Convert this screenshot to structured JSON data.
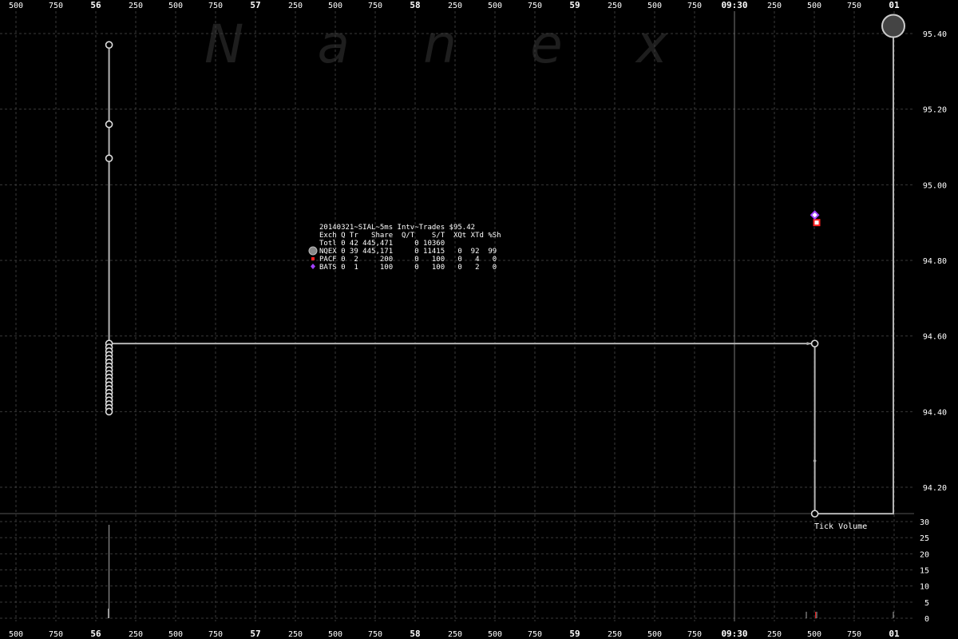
{
  "watermark": "Nanex",
  "info": {
    "title": "20140321~SIAL~5ms Intv~Trades $95.42",
    "header": "Exch Q Tr   Share  Q/T    S/T  XQt XTd %Sh",
    "rows": [
      {
        "text": "Totl 0 42 445,471     0 10360",
        "marker": "none",
        "color": ""
      },
      {
        "text": "NQEX 0 39 445,171     0 11415   0  92  99",
        "marker": "circle",
        "color": "#aaaaaa"
      },
      {
        "text": "PACF 0  2     200     0   100   0   4   0",
        "marker": "square",
        "color": "#ff2020"
      },
      {
        "text": "BATS 0  1     100     0   100   0   2   0",
        "marker": "diamond",
        "color": "#a040ff"
      }
    ]
  },
  "volume_title": "Tick Volume",
  "colors": {
    "background": "#000000",
    "grid": "#3a3a3a",
    "price_line": "#b4b4b4",
    "nqex": "#aaaaaa",
    "pacf": "#ff2020",
    "bats": "#a040ff"
  },
  "chart_data": [
    {
      "type": "line",
      "title": "20140321~SIAL~5ms Intv~Trades $95.42",
      "x_unit": "milliseconds within the minute (timeline around 09:30)",
      "x_tick_labels": [
        "500",
        "750",
        "56",
        "250",
        "500",
        "750",
        "57",
        "250",
        "500",
        "750",
        "58",
        "250",
        "500",
        "750",
        "59",
        "250",
        "500",
        "750",
        "09:30",
        "250",
        "500",
        "750",
        "01"
      ],
      "x_major_labels": [
        "56",
        "57",
        "58",
        "59",
        "09:30",
        "01"
      ],
      "ylim": [
        94.1,
        95.5
      ],
      "y_ticks": [
        "95.40",
        "95.20",
        "95.00",
        "94.80",
        "94.60",
        "94.40",
        "94.20"
      ],
      "grid": true,
      "series": [
        {
          "name": "NQEX",
          "points": [
            {
              "x": 583,
              "y": 95.37
            },
            {
              "x": 583,
              "y": 95.16
            },
            {
              "x": 583,
              "y": 95.07
            },
            {
              "x": 583,
              "y": 94.58
            },
            {
              "x": 583,
              "y": 94.57
            },
            {
              "x": 583,
              "y": 94.56
            },
            {
              "x": 583,
              "y": 94.55
            },
            {
              "x": 583,
              "y": 94.54
            },
            {
              "x": 583,
              "y": 94.53
            },
            {
              "x": 583,
              "y": 94.52
            },
            {
              "x": 583,
              "y": 94.51
            },
            {
              "x": 583,
              "y": 94.5
            },
            {
              "x": 583,
              "y": 94.49
            },
            {
              "x": 583,
              "y": 94.48
            },
            {
              "x": 583,
              "y": 94.47
            },
            {
              "x": 583,
              "y": 94.46
            },
            {
              "x": 583,
              "y": 94.45
            },
            {
              "x": 583,
              "y": 94.44
            },
            {
              "x": 583,
              "y": 94.43
            },
            {
              "x": 583,
              "y": 94.42
            },
            {
              "x": 583,
              "y": 94.41
            },
            {
              "x": 583,
              "y": 94.4
            },
            {
              "x": 4958,
              "y": 94.58
            },
            {
              "x": 5003,
              "y": 94.58
            },
            {
              "x": 5003,
              "y": 94.27
            },
            {
              "x": 5003,
              "y": 94.13
            },
            {
              "x": 5495,
              "y": 95.42
            }
          ],
          "path": [
            {
              "x": 583,
              "y": 95.37
            },
            {
              "x": 583,
              "y": 94.4
            },
            {
              "x": 583,
              "y": 94.58
            },
            {
              "x": 5003,
              "y": 94.58
            },
            {
              "x": 5003,
              "y": 94.13
            },
            {
              "x": 5495,
              "y": 94.13
            },
            {
              "x": 5495,
              "y": 95.42
            }
          ]
        },
        {
          "name": "PACF",
          "points": [
            {
              "x": 5015,
              "y": 94.9
            }
          ]
        },
        {
          "name": "BATS",
          "points": [
            {
              "x": 5003,
              "y": 94.92
            }
          ]
        }
      ]
    },
    {
      "type": "bar",
      "title": "Tick Volume",
      "ylim": [
        0,
        30
      ],
      "y_ticks": [
        "30",
        "25",
        "20",
        "15",
        "10",
        "5",
        "0"
      ],
      "bars": [
        {
          "x": 583,
          "value": 29,
          "color": "#aaaaaa"
        },
        {
          "x": 578,
          "value": 3,
          "color": "#aaaaaa"
        },
        {
          "x": 4950,
          "value": 2,
          "color": "#aaaaaa"
        },
        {
          "x": 5008,
          "value": 2,
          "color": "#ff2020"
        },
        {
          "x": 5015,
          "value": 2,
          "color": "#aaaaaa"
        },
        {
          "x": 5495,
          "value": 2,
          "color": "#aaaaaa"
        }
      ]
    }
  ]
}
